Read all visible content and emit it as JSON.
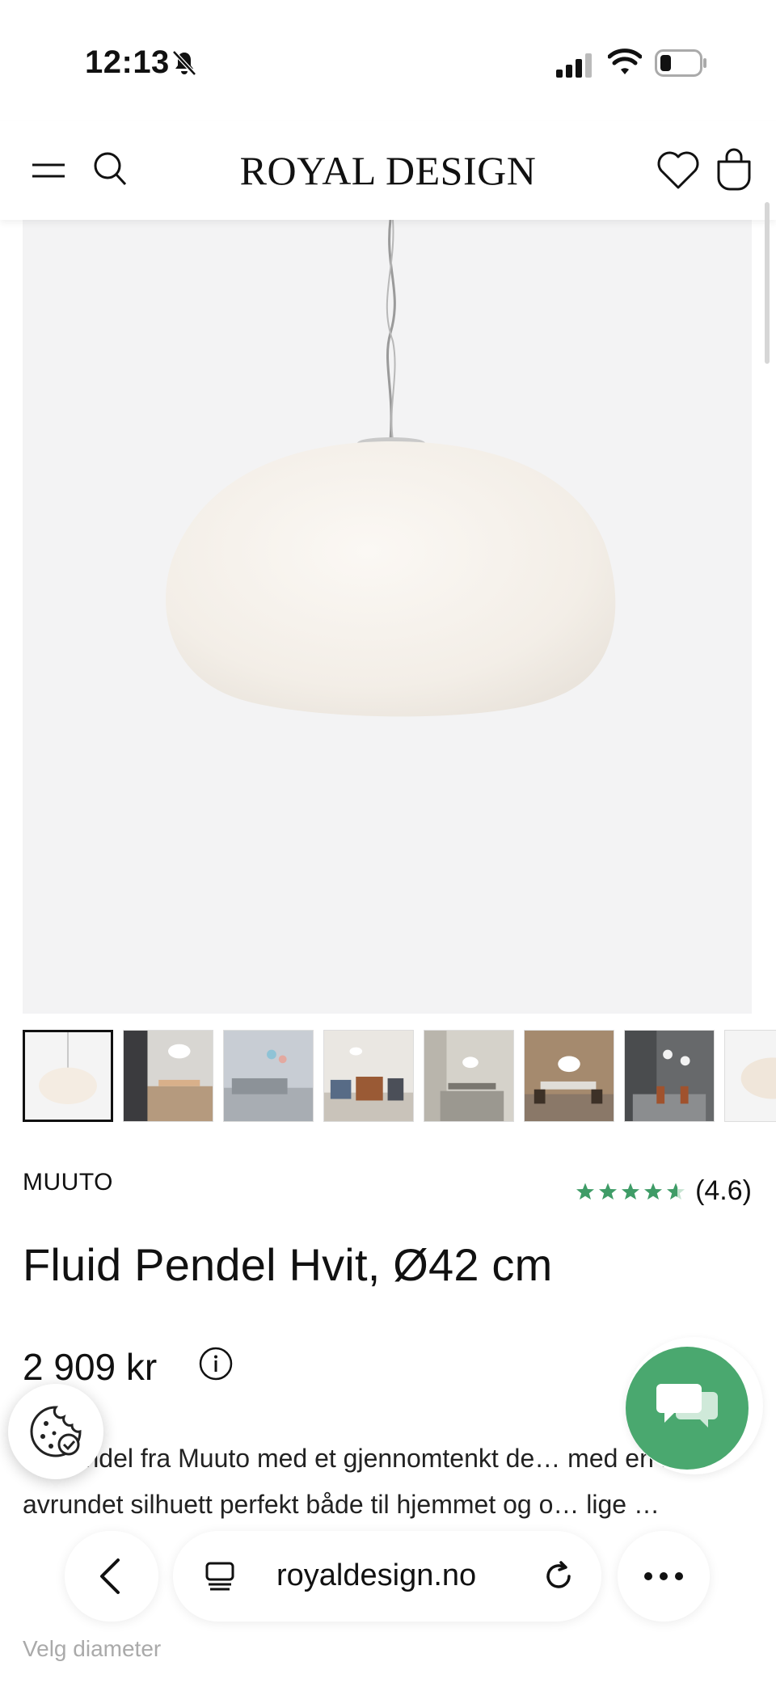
{
  "status_bar": {
    "time": "12:13"
  },
  "header": {
    "logo": "ROYAL DESIGN"
  },
  "product": {
    "brand": "MUUTO",
    "rating": "(4.6)",
    "stars": 4.6,
    "title": "Fluid Pendel Hvit, Ø42 cm",
    "price": "2 909 kr",
    "description": "… pendel fra Muuto med et gjennomtenkt de… med en lett avrundet silhuett perfekt både til hjemmet og o… lige …",
    "variant_label": "Velg diameter"
  },
  "browser": {
    "url": "royaldesign.no"
  },
  "colors": {
    "accent_green": "#4aa86f",
    "star_green": "#3f9c67",
    "image_bg": "#f3f3f4"
  },
  "icons": [
    "bell-slash-icon",
    "signal-icon",
    "wifi-icon",
    "battery-icon",
    "menu-icon",
    "search-icon",
    "heart-icon",
    "bag-icon",
    "star-icon",
    "info-icon",
    "cookie-icon",
    "chat-icon",
    "back-icon",
    "tabs-icon",
    "reload-icon",
    "more-icon"
  ]
}
